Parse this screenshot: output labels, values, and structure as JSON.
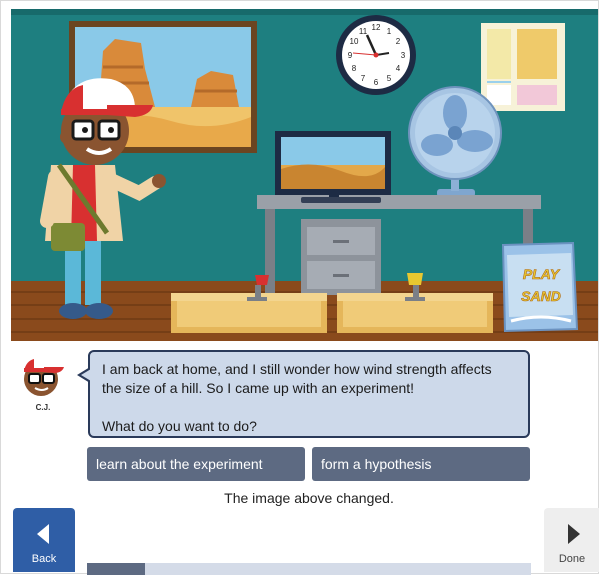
{
  "speaker": {
    "name": "C.J."
  },
  "dialog": {
    "line1": "I am back at home, and I still wonder how wind strength affects",
    "line2": "the size of a hill. So I came up with an experiment!",
    "line3": "What do you want to do?"
  },
  "choices": [
    {
      "label": "learn about the experiment"
    },
    {
      "label": "form a hypothesis"
    }
  ],
  "status_text": "The image above changed.",
  "nav": {
    "back_label": "Back",
    "done_label": "Done"
  },
  "scene": {
    "sand_bag_text_line1": "PLAY",
    "sand_bag_text_line2": "SAND",
    "clock_numbers": [
      "12",
      "1",
      "2",
      "3",
      "4",
      "5",
      "6",
      "7",
      "8",
      "9",
      "10",
      "11"
    ]
  },
  "progress": {
    "fraction": 0.13
  },
  "colors": {
    "wall": "#1e7f80",
    "button": "#5d6a82",
    "back_button": "#2f5ea6",
    "bubble": "#cdd9ea"
  }
}
